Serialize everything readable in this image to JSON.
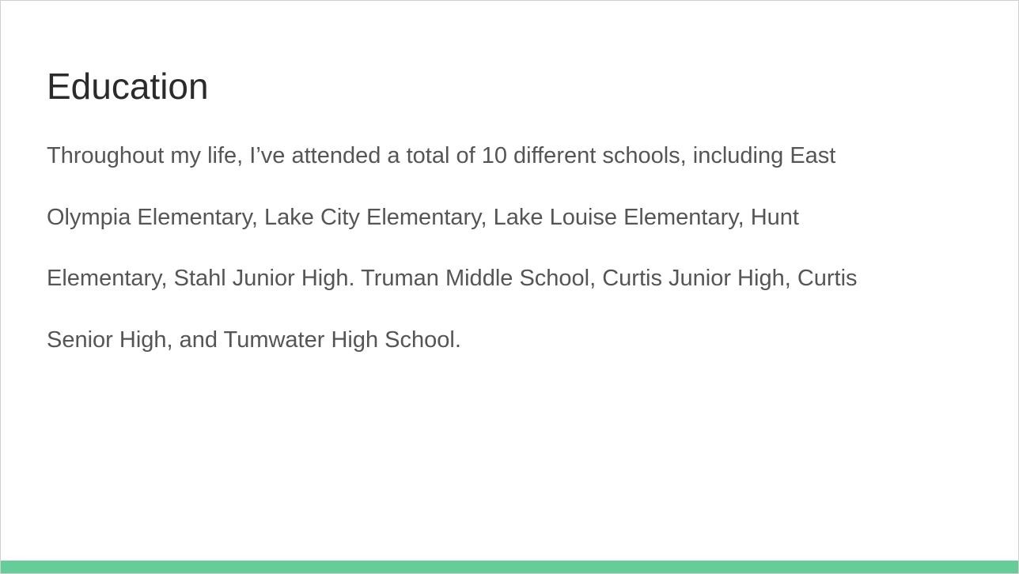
{
  "slide": {
    "title": "Education",
    "body_lines": [
      "Throughout my life, I’ve attended a total of 10 different schools, including East",
      "Olympia Elementary, Lake City Elementary, Lake Louise Elementary, Hunt",
      "Elementary, Stahl Junior High. Truman Middle School, Curtis Junior High, Curtis",
      "Senior High, and Tumwater High School."
    ]
  },
  "colors": {
    "accent_bar": "#66cc99",
    "title": "#2b2b2b",
    "body": "#555555",
    "background": "#ffffff"
  }
}
